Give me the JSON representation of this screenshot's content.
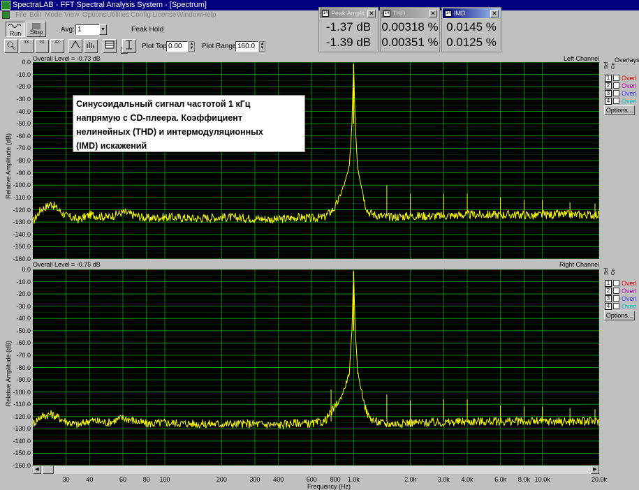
{
  "window": {
    "title": "SpectraLAB - FFT Spectral Analysis System - [Spectrum]"
  },
  "menu": {
    "items": [
      "File",
      "Edit",
      "Mode",
      "View",
      "Options",
      "Utilities",
      "Config",
      "License",
      "Window",
      "Help"
    ]
  },
  "toolbar": {
    "run_label": "Run",
    "stop_label": "Stop",
    "avg_label": "Avg:",
    "avg_value": "1",
    "peak_hold_label": "Peak Hold",
    "plot_top_label": "Plot Top:",
    "plot_top_value": "0.00",
    "plot_range_label": "Plot Range:",
    "plot_range_value": "160.0"
  },
  "meters": [
    {
      "title": "Peak Amplit",
      "values": [
        "-1.37 dB",
        "-1.39 dB"
      ]
    },
    {
      "title": "THD",
      "values": [
        "0.00318 %",
        "0.00351 %"
      ]
    },
    {
      "title": "IMD",
      "values": [
        "0.0145 %",
        "0.0125 %"
      ]
    }
  ],
  "annotation": {
    "lines": [
      "Синусоидальный сигнал  частотой 1 кГц",
      "напрямую с CD-плеера. Коэффициент",
      "нелинейных (THD) и интермодуляционных",
      "(IMD) искажений"
    ]
  },
  "panels": [
    {
      "overall": "Overall Level = -0.73 dB",
      "channel": "Left Channel"
    },
    {
      "overall": "Overall Level = -0.75 dB",
      "channel": "Right Channel"
    }
  ],
  "overlays": {
    "title": "Overlays",
    "col_headers": [
      "Sel",
      "On"
    ],
    "items": [
      {
        "num": "1",
        "name": "Overla",
        "color": "#ff0000"
      },
      {
        "num": "2",
        "name": "Overla",
        "color": "#c000c0"
      },
      {
        "num": "3",
        "name": "Overla",
        "color": "#4040ff"
      },
      {
        "num": "4",
        "name": "Overla",
        "color": "#00c0c0"
      }
    ],
    "options_label": "Options..."
  },
  "chart_data": [
    {
      "type": "line",
      "title": "Left Channel",
      "xlabel": "Frequency (Hz)",
      "ylabel": "Relative Amplitude (dB)",
      "xscale": "log",
      "xlim": [
        20,
        20000
      ],
      "ylim": [
        -160,
        0
      ],
      "grid": true,
      "line_color": "#ffff00",
      "grid_color": "#00a000",
      "y_ticks": [
        "0.0",
        "-10.0",
        "-20.0",
        "-30.0",
        "-40.0",
        "-50.0",
        "-60.0",
        "-70.0",
        "-80.0",
        "-90.0",
        "-100.0",
        "-110.0",
        "-120.0",
        "-130.0",
        "-140.0",
        "-150.0",
        "-160.0"
      ],
      "x_ticks": [
        "30",
        "40",
        "60",
        "80",
        "100",
        "200",
        "300",
        "400",
        "600",
        "800",
        "1.0k",
        "2.0k",
        "3.0k",
        "4.0k",
        "6.0k",
        "8.0k",
        "10.0k",
        "20.0k"
      ],
      "series": [
        {
          "x": [
            20,
            22,
            25,
            30,
            35,
            40,
            50,
            60,
            80,
            100,
            150,
            200,
            300,
            400,
            500,
            600,
            700,
            750,
            800,
            850,
            900,
            950,
            980,
            1000,
            1020,
            1050,
            1100,
            1150,
            1200,
            1300,
            1500,
            2000,
            2500,
            3000,
            4000,
            5000,
            6000,
            7000,
            8000,
            9000,
            10000,
            12000,
            15000,
            20000
          ],
          "y": [
            -130,
            -120,
            -115,
            -125,
            -128,
            -124,
            -126,
            -122,
            -127,
            -126,
            -127,
            -126,
            -127,
            -128,
            -126,
            -127,
            -126,
            -122,
            -118,
            -108,
            -98,
            -85,
            -50,
            -1.4,
            -50,
            -85,
            -100,
            -115,
            -122,
            -124,
            -126,
            -125,
            -125,
            -125,
            -124,
            -124,
            -124,
            -124,
            -124,
            -125,
            -124,
            -124,
            -124,
            -124
          ]
        }
      ],
      "spurs": [
        {
          "x": 1500,
          "y": -100
        },
        {
          "x": 2000,
          "y": -107
        },
        {
          "x": 3000,
          "y": -107
        },
        {
          "x": 4000,
          "y": -107
        },
        {
          "x": 6000,
          "y": -110
        },
        {
          "x": 8000,
          "y": -112
        },
        {
          "x": 10000,
          "y": -112
        },
        {
          "x": 14000,
          "y": -114
        },
        {
          "x": 19000,
          "y": -115
        }
      ]
    },
    {
      "type": "line",
      "title": "Right Channel",
      "xlabel": "Frequency (Hz)",
      "ylabel": "Relative Amplitude (dB)",
      "xscale": "log",
      "xlim": [
        20,
        20000
      ],
      "ylim": [
        -160,
        0
      ],
      "grid": true,
      "line_color": "#ffff00",
      "grid_color": "#00a000",
      "y_ticks": [
        "0.0",
        "-10.0",
        "-20.0",
        "-30.0",
        "-40.0",
        "-50.0",
        "-60.0",
        "-70.0",
        "-80.0",
        "-90.0",
        "-100.0",
        "-110.0",
        "-120.0",
        "-130.0",
        "-140.0",
        "-150.0",
        "-160.0"
      ],
      "x_ticks": [
        "30",
        "40",
        "60",
        "80",
        "100",
        "200",
        "300",
        "400",
        "600",
        "800",
        "1.0k",
        "2.0k",
        "3.0k",
        "4.0k",
        "6.0k",
        "8.0k",
        "10.0k",
        "20.0k"
      ],
      "series": [
        {
          "x": [
            20,
            22,
            25,
            30,
            35,
            40,
            50,
            60,
            80,
            100,
            150,
            200,
            300,
            400,
            500,
            600,
            700,
            750,
            800,
            850,
            900,
            950,
            980,
            1000,
            1020,
            1050,
            1100,
            1150,
            1200,
            1300,
            1500,
            2000,
            2500,
            3000,
            4000,
            5000,
            6000,
            7000,
            8000,
            9000,
            10000,
            12000,
            15000,
            20000
          ],
          "y": [
            -126,
            -120,
            -118,
            -124,
            -127,
            -123,
            -125,
            -121,
            -126,
            -125,
            -126,
            -126,
            -126,
            -127,
            -125,
            -126,
            -124,
            -118,
            -112,
            -106,
            -96,
            -84,
            -50,
            -1.4,
            -50,
            -84,
            -98,
            -112,
            -120,
            -124,
            -126,
            -125,
            -125,
            -125,
            -124,
            -124,
            -124,
            -124,
            -124,
            -124,
            -124,
            -124,
            -124,
            -124
          ]
        }
      ],
      "spurs": [
        {
          "x": 760,
          "y": -98
        },
        {
          "x": 1500,
          "y": -102
        },
        {
          "x": 2000,
          "y": -107
        },
        {
          "x": 3000,
          "y": -106
        },
        {
          "x": 4000,
          "y": -106
        },
        {
          "x": 6000,
          "y": -111
        },
        {
          "x": 8000,
          "y": -112
        },
        {
          "x": 10000,
          "y": -112
        },
        {
          "x": 14000,
          "y": -113
        },
        {
          "x": 19000,
          "y": -114
        }
      ]
    }
  ]
}
